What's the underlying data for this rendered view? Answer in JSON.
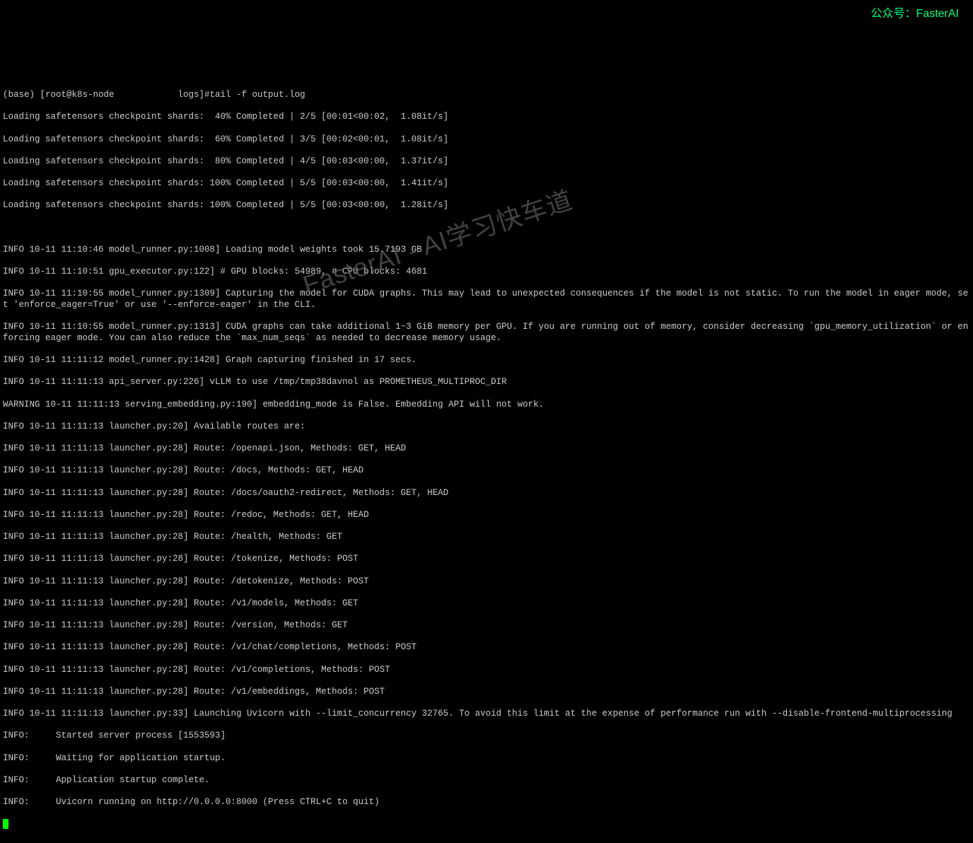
{
  "watermark": {
    "corner": "公众号：FasterAI",
    "diagonal": "FasterAI - AI学习快车道"
  },
  "prompt": "(base) [root@k8s-node            logs]#tail -f output.log",
  "loading_lines": [
    "Loading safetensors checkpoint shards:  40% Completed | 2/5 [00:01<00:02,  1.08it/s]",
    "Loading safetensors checkpoint shards:  60% Completed | 3/5 [00:02<00:01,  1.08it/s]",
    "Loading safetensors checkpoint shards:  80% Completed | 4/5 [00:03<00:00,  1.37it/s]",
    "Loading safetensors checkpoint shards: 100% Completed | 5/5 [00:03<00:00,  1.41it/s]",
    "Loading safetensors checkpoint shards: 100% Completed | 5/5 [00:03<00:00,  1.28it/s]"
  ],
  "info_lines": [
    "INFO 10-11 11:10:46 model_runner.py:1008] Loading model weights took 15.7193 GB",
    "INFO 10-11 11:10:51 gpu_executor.py:122] # GPU blocks: 54989, # CPU blocks: 4681",
    "INFO 10-11 11:10:55 model_runner.py:1309] Capturing the model for CUDA graphs. This may lead to unexpected consequences if the model is not static. To run the model in eager mode, set 'enforce_eager=True' or use '--enforce-eager' in the CLI.",
    "INFO 10-11 11:10:55 model_runner.py:1313] CUDA graphs can take additional 1~3 GiB memory per GPU. If you are running out of memory, consider decreasing `gpu_memory_utilization` or enforcing eager mode. You can also reduce the `max_num_seqs` as needed to decrease memory usage.",
    "INFO 10-11 11:11:12 model_runner.py:1428] Graph capturing finished in 17 secs.",
    "INFO 10-11 11:11:13 api_server.py:226] vLLM to use /tmp/tmp38davnol as PROMETHEUS_MULTIPROC_DIR",
    "WARNING 10-11 11:11:13 serving_embedding.py:190] embedding_mode is False. Embedding API will not work.",
    "INFO 10-11 11:11:13 launcher.py:20] Available routes are:",
    "INFO 10-11 11:11:13 launcher.py:28] Route: /openapi.json, Methods: GET, HEAD",
    "INFO 10-11 11:11:13 launcher.py:28] Route: /docs, Methods: GET, HEAD",
    "INFO 10-11 11:11:13 launcher.py:28] Route: /docs/oauth2-redirect, Methods: GET, HEAD",
    "INFO 10-11 11:11:13 launcher.py:28] Route: /redoc, Methods: GET, HEAD",
    "INFO 10-11 11:11:13 launcher.py:28] Route: /health, Methods: GET",
    "INFO 10-11 11:11:13 launcher.py:28] Route: /tokenize, Methods: POST",
    "INFO 10-11 11:11:13 launcher.py:28] Route: /detokenize, Methods: POST",
    "INFO 10-11 11:11:13 launcher.py:28] Route: /v1/models, Methods: GET",
    "INFO 10-11 11:11:13 launcher.py:28] Route: /version, Methods: GET",
    "INFO 10-11 11:11:13 launcher.py:28] Route: /v1/chat/completions, Methods: POST",
    "INFO 10-11 11:11:13 launcher.py:28] Route: /v1/completions, Methods: POST",
    "INFO 10-11 11:11:13 launcher.py:28] Route: /v1/embeddings, Methods: POST",
    "INFO 10-11 11:11:13 launcher.py:33] Launching Uvicorn with --limit_concurrency 32765. To avoid this limit at the expense of performance run with --disable-frontend-multiprocessing",
    "INFO:     Started server process [1553593]",
    "INFO:     Waiting for application startup.",
    "INFO:     Application startup complete.",
    "INFO:     Uvicorn running on http://0.0.0.0:8000 (Press CTRL+C to quit)"
  ]
}
